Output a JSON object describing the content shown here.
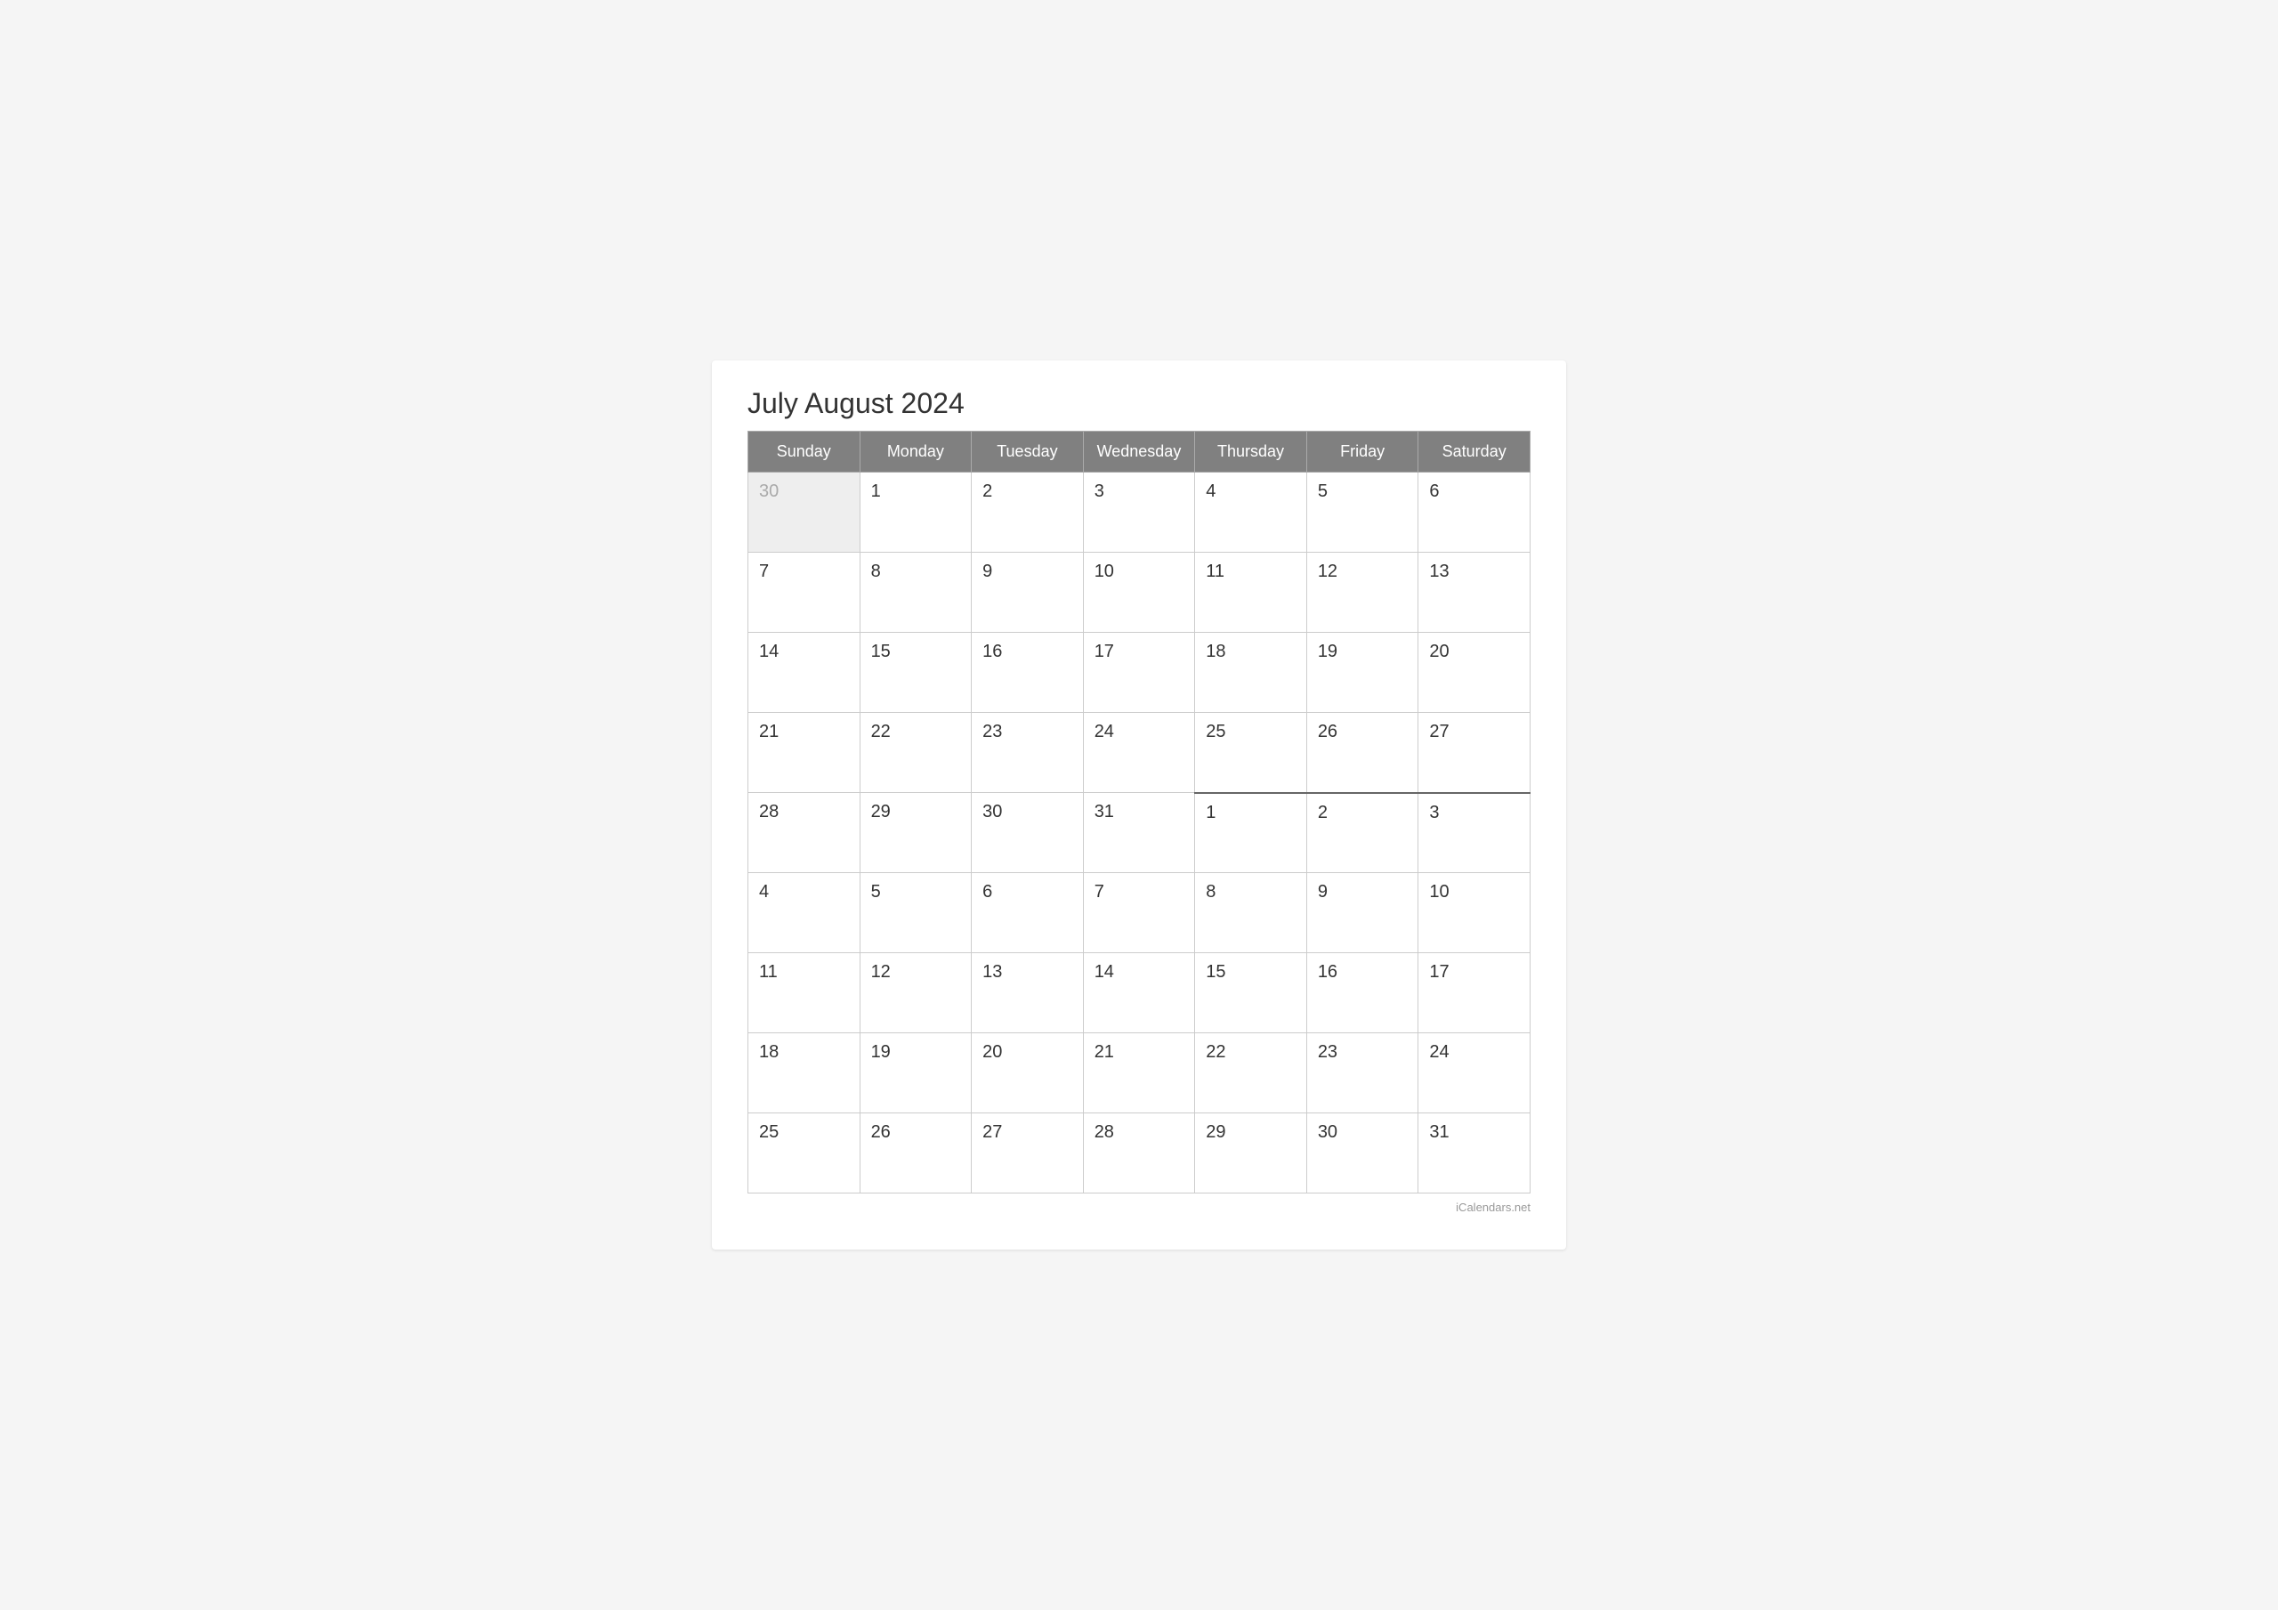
{
  "calendar": {
    "title": "July August 2024",
    "watermark": "iCalendars.net",
    "headers": [
      "Sunday",
      "Monday",
      "Tuesday",
      "Wednesday",
      "Thursday",
      "Friday",
      "Saturday"
    ],
    "rows": [
      [
        {
          "day": "30",
          "otherMonth": true,
          "newMonthStart": false
        },
        {
          "day": "1",
          "otherMonth": false,
          "newMonthStart": false
        },
        {
          "day": "2",
          "otherMonth": false,
          "newMonthStart": false
        },
        {
          "day": "3",
          "otherMonth": false,
          "newMonthStart": false
        },
        {
          "day": "4",
          "otherMonth": false,
          "newMonthStart": false
        },
        {
          "day": "5",
          "otherMonth": false,
          "newMonthStart": false
        },
        {
          "day": "6",
          "otherMonth": false,
          "newMonthStart": false
        }
      ],
      [
        {
          "day": "7",
          "otherMonth": false,
          "newMonthStart": false
        },
        {
          "day": "8",
          "otherMonth": false,
          "newMonthStart": false
        },
        {
          "day": "9",
          "otherMonth": false,
          "newMonthStart": false
        },
        {
          "day": "10",
          "otherMonth": false,
          "newMonthStart": false
        },
        {
          "day": "11",
          "otherMonth": false,
          "newMonthStart": false
        },
        {
          "day": "12",
          "otherMonth": false,
          "newMonthStart": false
        },
        {
          "day": "13",
          "otherMonth": false,
          "newMonthStart": false
        }
      ],
      [
        {
          "day": "14",
          "otherMonth": false,
          "newMonthStart": false
        },
        {
          "day": "15",
          "otherMonth": false,
          "newMonthStart": false
        },
        {
          "day": "16",
          "otherMonth": false,
          "newMonthStart": false
        },
        {
          "day": "17",
          "otherMonth": false,
          "newMonthStart": false
        },
        {
          "day": "18",
          "otherMonth": false,
          "newMonthStart": false
        },
        {
          "day": "19",
          "otherMonth": false,
          "newMonthStart": false
        },
        {
          "day": "20",
          "otherMonth": false,
          "newMonthStart": false
        }
      ],
      [
        {
          "day": "21",
          "otherMonth": false,
          "newMonthStart": false
        },
        {
          "day": "22",
          "otherMonth": false,
          "newMonthStart": false
        },
        {
          "day": "23",
          "otherMonth": false,
          "newMonthStart": false
        },
        {
          "day": "24",
          "otherMonth": false,
          "newMonthStart": false
        },
        {
          "day": "25",
          "otherMonth": false,
          "newMonthStart": false
        },
        {
          "day": "26",
          "otherMonth": false,
          "newMonthStart": false
        },
        {
          "day": "27",
          "otherMonth": false,
          "newMonthStart": false
        }
      ],
      [
        {
          "day": "28",
          "otherMonth": false,
          "newMonthStart": false
        },
        {
          "day": "29",
          "otherMonth": false,
          "newMonthStart": false
        },
        {
          "day": "30",
          "otherMonth": false,
          "newMonthStart": false
        },
        {
          "day": "31",
          "otherMonth": false,
          "newMonthStart": false
        },
        {
          "day": "1",
          "otherMonth": false,
          "newMonthStart": true
        },
        {
          "day": "2",
          "otherMonth": false,
          "newMonthStart": true
        },
        {
          "day": "3",
          "otherMonth": false,
          "newMonthStart": true
        }
      ],
      [
        {
          "day": "4",
          "otherMonth": false,
          "newMonthStart": false
        },
        {
          "day": "5",
          "otherMonth": false,
          "newMonthStart": false
        },
        {
          "day": "6",
          "otherMonth": false,
          "newMonthStart": false
        },
        {
          "day": "7",
          "otherMonth": false,
          "newMonthStart": false
        },
        {
          "day": "8",
          "otherMonth": false,
          "newMonthStart": false
        },
        {
          "day": "9",
          "otherMonth": false,
          "newMonthStart": false
        },
        {
          "day": "10",
          "otherMonth": false,
          "newMonthStart": false
        }
      ],
      [
        {
          "day": "11",
          "otherMonth": false,
          "newMonthStart": false
        },
        {
          "day": "12",
          "otherMonth": false,
          "newMonthStart": false
        },
        {
          "day": "13",
          "otherMonth": false,
          "newMonthStart": false
        },
        {
          "day": "14",
          "otherMonth": false,
          "newMonthStart": false
        },
        {
          "day": "15",
          "otherMonth": false,
          "newMonthStart": false
        },
        {
          "day": "16",
          "otherMonth": false,
          "newMonthStart": false
        },
        {
          "day": "17",
          "otherMonth": false,
          "newMonthStart": false
        }
      ],
      [
        {
          "day": "18",
          "otherMonth": false,
          "newMonthStart": false
        },
        {
          "day": "19",
          "otherMonth": false,
          "newMonthStart": false
        },
        {
          "day": "20",
          "otherMonth": false,
          "newMonthStart": false
        },
        {
          "day": "21",
          "otherMonth": false,
          "newMonthStart": false
        },
        {
          "day": "22",
          "otherMonth": false,
          "newMonthStart": false
        },
        {
          "day": "23",
          "otherMonth": false,
          "newMonthStart": false
        },
        {
          "day": "24",
          "otherMonth": false,
          "newMonthStart": false
        }
      ],
      [
        {
          "day": "25",
          "otherMonth": false,
          "newMonthStart": false
        },
        {
          "day": "26",
          "otherMonth": false,
          "newMonthStart": false
        },
        {
          "day": "27",
          "otherMonth": false,
          "newMonthStart": false
        },
        {
          "day": "28",
          "otherMonth": false,
          "newMonthStart": false
        },
        {
          "day": "29",
          "otherMonth": false,
          "newMonthStart": false
        },
        {
          "day": "30",
          "otherMonth": false,
          "newMonthStart": false
        },
        {
          "day": "31",
          "otherMonth": false,
          "newMonthStart": false
        }
      ]
    ]
  }
}
